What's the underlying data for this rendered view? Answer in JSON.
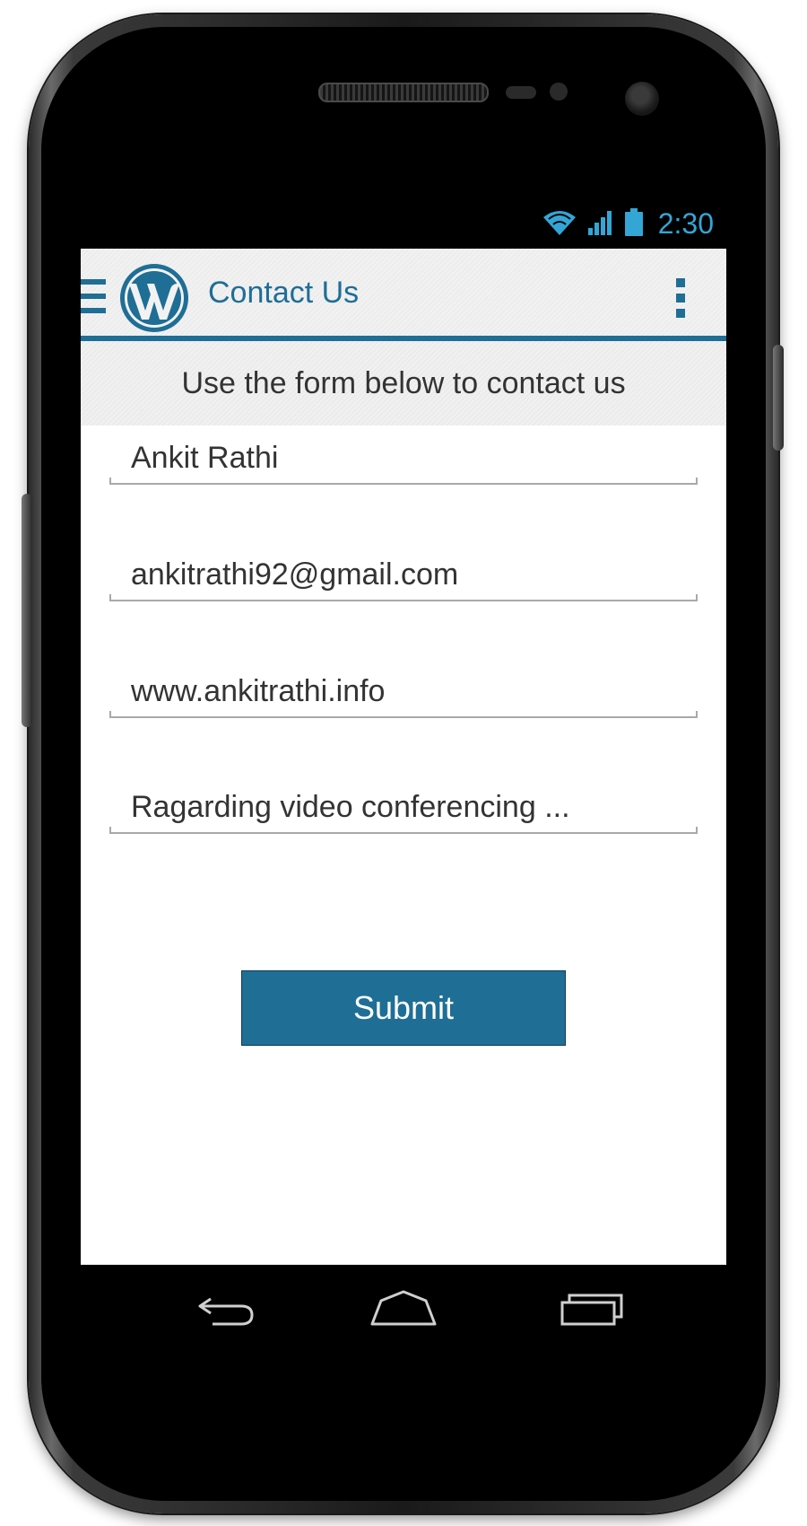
{
  "status_bar": {
    "time": "2:30",
    "icons": [
      "wifi-icon",
      "signal-icon",
      "battery-icon"
    ],
    "accent_color": "#33a6d6"
  },
  "app_bar": {
    "title": "Contact Us",
    "menu_icon": "hamburger-menu-icon",
    "logo": "wordpress-logo",
    "overflow_icon": "overflow-menu-icon",
    "accent_color": "#1f6e96"
  },
  "form": {
    "intro": "Use the form below to contact us",
    "fields": {
      "name": {
        "value": "Ankit Rathi"
      },
      "email": {
        "value": "ankitrathi92@gmail.com"
      },
      "website": {
        "value": "www.ankitrathi.info"
      },
      "message": {
        "value": "Ragarding video conferencing ..."
      }
    },
    "submit_label": "Submit"
  },
  "nav_bar": {
    "buttons": [
      "back-icon",
      "home-icon",
      "recent-apps-icon"
    ]
  }
}
